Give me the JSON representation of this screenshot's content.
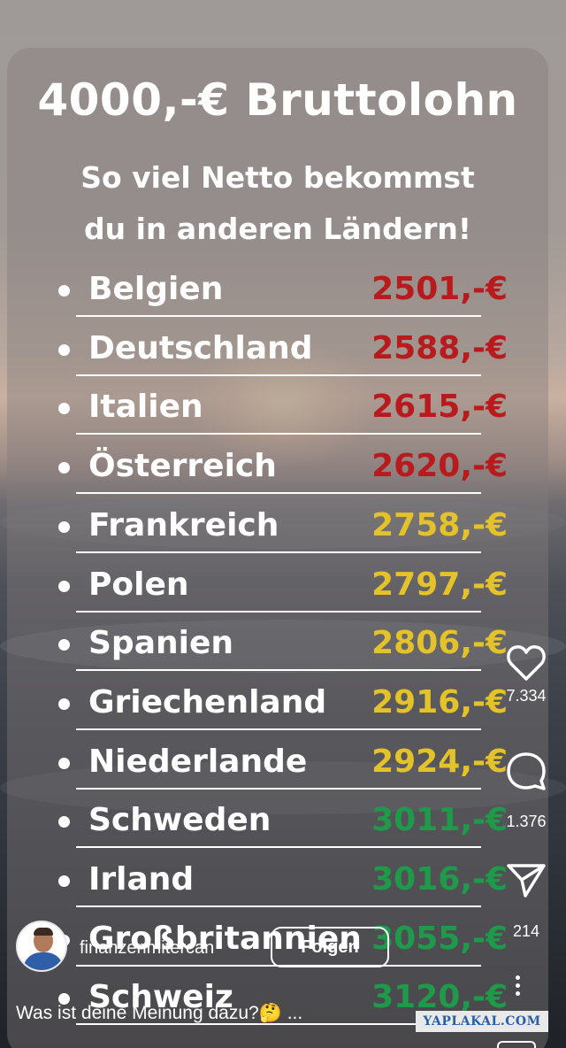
{
  "post": {
    "title": "4000,-€ Bruttolohn",
    "subtitle_line1": "So viel Netto bekommst",
    "subtitle_line2": "du in anderen Ländern!",
    "rows": [
      {
        "country": "Belgien",
        "amount": "2501,-€",
        "color": "#b81a1e"
      },
      {
        "country": "Deutschland",
        "amount": "2588,-€",
        "color": "#b81a1e"
      },
      {
        "country": "Italien",
        "amount": "2615,-€",
        "color": "#b81a1e"
      },
      {
        "country": "Österreich",
        "amount": "2620,-€",
        "color": "#b81a1e"
      },
      {
        "country": "Frankreich",
        "amount": "2758,-€",
        "color": "#e3c22a"
      },
      {
        "country": "Polen",
        "amount": "2797,-€",
        "color": "#e3c22a"
      },
      {
        "country": "Spanien",
        "amount": "2806,-€",
        "color": "#e3c22a"
      },
      {
        "country": "Griechenland",
        "amount": "2916,-€",
        "color": "#e3c22a"
      },
      {
        "country": "Niederlande",
        "amount": "2924,-€",
        "color": "#e3c22a"
      },
      {
        "country": "Schweden",
        "amount": "3011,-€",
        "color": "#1f9a4a"
      },
      {
        "country": "Irland",
        "amount": "3016,-€",
        "color": "#1f9a4a"
      },
      {
        "country": "Großbritannien",
        "amount": "3055,-€",
        "color": "#1f9a4a"
      },
      {
        "country": "Schweiz",
        "amount": "3120,-€",
        "color": "#1f9a4a"
      }
    ]
  },
  "actions": {
    "like_icon": "heart-icon",
    "like_count": "7.334",
    "comment_icon": "comment-bubble-icon",
    "comment_count": "1.376",
    "share_icon": "paper-plane-icon",
    "share_count": "214",
    "more_icon": "more-vertical-icon"
  },
  "author": {
    "username": "finanzenmitercan",
    "follow_label": "Folgen"
  },
  "caption": "Was ist deine Meinung dazu?🤔 ...",
  "watermark": "YAPLAKAL.COM"
}
